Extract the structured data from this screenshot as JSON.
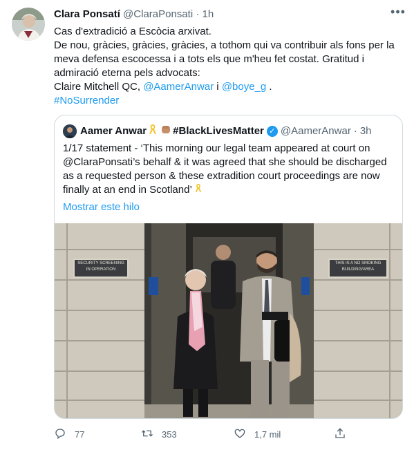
{
  "tweet": {
    "author_name": "Clara Ponsatí",
    "author_handle": "@ClaraPonsati",
    "separator": "·",
    "time": "1h",
    "lines": [
      "Cas d'extradició a Escòcia arxivat.",
      "De nou, gràcies, gràcies, gràcies, a tothom qui va contribuir als fons per la meva defensa escocessa i a tots els que m'heu fet costat. Gratitud i admiració eterna pels advocats:"
    ],
    "lawyers_prefix": "Claire Mitchell QC, ",
    "mention1": "@AamerAnwar",
    "lawyers_mid": " i ",
    "mention2": "@boye_g",
    "lawyers_suffix": " .",
    "hashtag": "#NoSurrender"
  },
  "quote": {
    "name": "Aamer Anwar",
    "name_suffix": "#BlackLivesMatter",
    "handle": "@AamerAnwar",
    "separator": "·",
    "time": "3h",
    "text": "1/17 statement - ‘This morning our legal team appeared at court on @ClaraPonsati’s behalf & it was agreed that she should be discharged as a requested person & these extradition court proceedings are now finally at an end in Scotland’",
    "show_thread": "Mostrar este hilo",
    "sign_left": "SECURITY SCREENING IN OPERATION",
    "sign_right": "THIS IS A NO SMOKING BUILDING/AREA"
  },
  "actions": {
    "replies": "77",
    "retweets": "353",
    "likes": "1,7 mil"
  },
  "colors": {
    "accent": "#1d9bf0",
    "muted": "#536471",
    "border": "#cfd9de"
  },
  "icons": [
    "more-icon",
    "verified-icon",
    "ribbon-icon",
    "fist-icon",
    "reply-icon",
    "retweet-icon",
    "like-icon",
    "share-icon"
  ]
}
